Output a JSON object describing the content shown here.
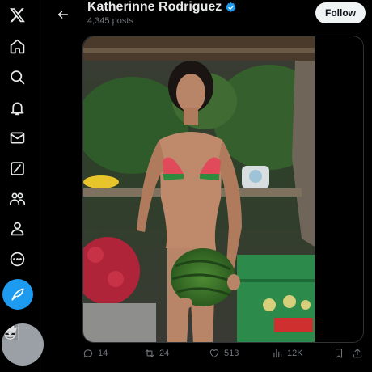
{
  "profile": {
    "name": "Katherinne Rodriguez",
    "posts_count": "4,345 posts",
    "follow_label": "Follow",
    "verified_color": "#1d9bf0"
  },
  "nav": {
    "items": [
      "x-logo-icon",
      "home-icon",
      "search-icon",
      "notifications-icon",
      "messages-icon",
      "grok-icon",
      "communities-icon",
      "profile-icon",
      "more-icon"
    ],
    "compose_icon": "post-compose-icon",
    "accent": "#1d9bf0"
  },
  "post": {
    "media_alt": "photo",
    "replies": "14",
    "reposts": "24",
    "likes": "513",
    "views": "12K"
  },
  "colors": {
    "background": "#000000",
    "text": "#e7e9ea",
    "muted": "#71767b",
    "border": "#2f3336"
  }
}
